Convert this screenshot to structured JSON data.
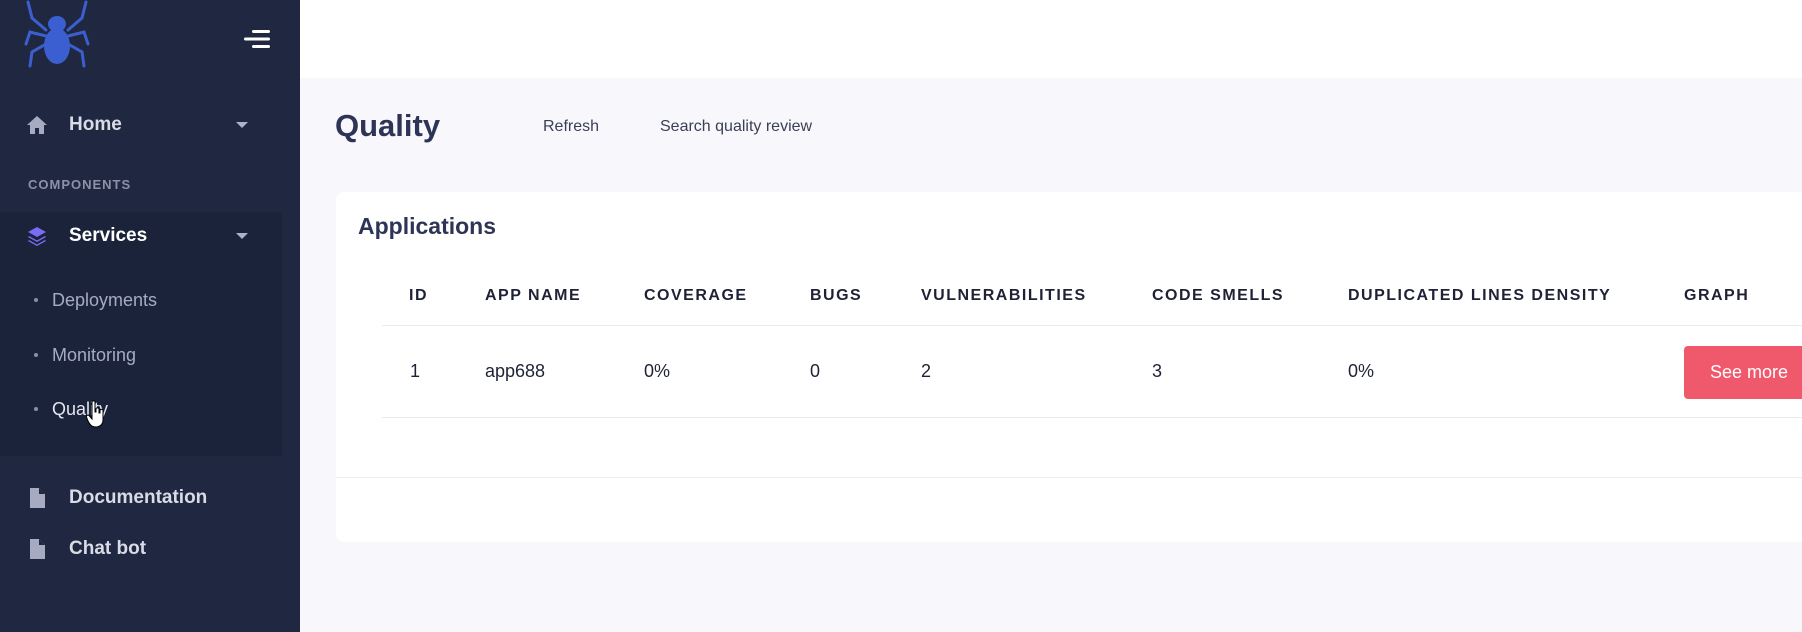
{
  "sidebar": {
    "home_label": "Home",
    "section_label": "COMPONENTS",
    "services_label": "Services",
    "sub_items": [
      "Deployments",
      "Monitoring",
      "Quality"
    ],
    "documentation_label": "Documentation",
    "chatbot_label": "Chat bot"
  },
  "header": {
    "title": "Quality",
    "refresh_label": "Refresh",
    "search_label": "Search quality review"
  },
  "card": {
    "title": "Applications",
    "columns": [
      "ID",
      "APP NAME",
      "COVERAGE",
      "BUGS",
      "VULNERABILITIES",
      "CODE SMELLS",
      "DUPLICATED LINES DENSITY",
      "GRAPH"
    ],
    "rows": [
      {
        "id": "1",
        "app_name": "app688",
        "coverage": "0%",
        "bugs": "0",
        "vulnerabilities": "2",
        "code_smells": "3",
        "duplicated_lines_density": "0%",
        "graph_button": "See more"
      }
    ]
  },
  "colors": {
    "sidebar_bg": "#1f2840",
    "accent_button": "#f0596b",
    "logo_blue": "#3b5fd0",
    "services_icon": "#7b6cf6"
  },
  "icons": [
    "spider-logo",
    "menu-toggle-icon",
    "home-icon",
    "layers-icon",
    "file-icon",
    "hand-cursor-icon"
  ]
}
